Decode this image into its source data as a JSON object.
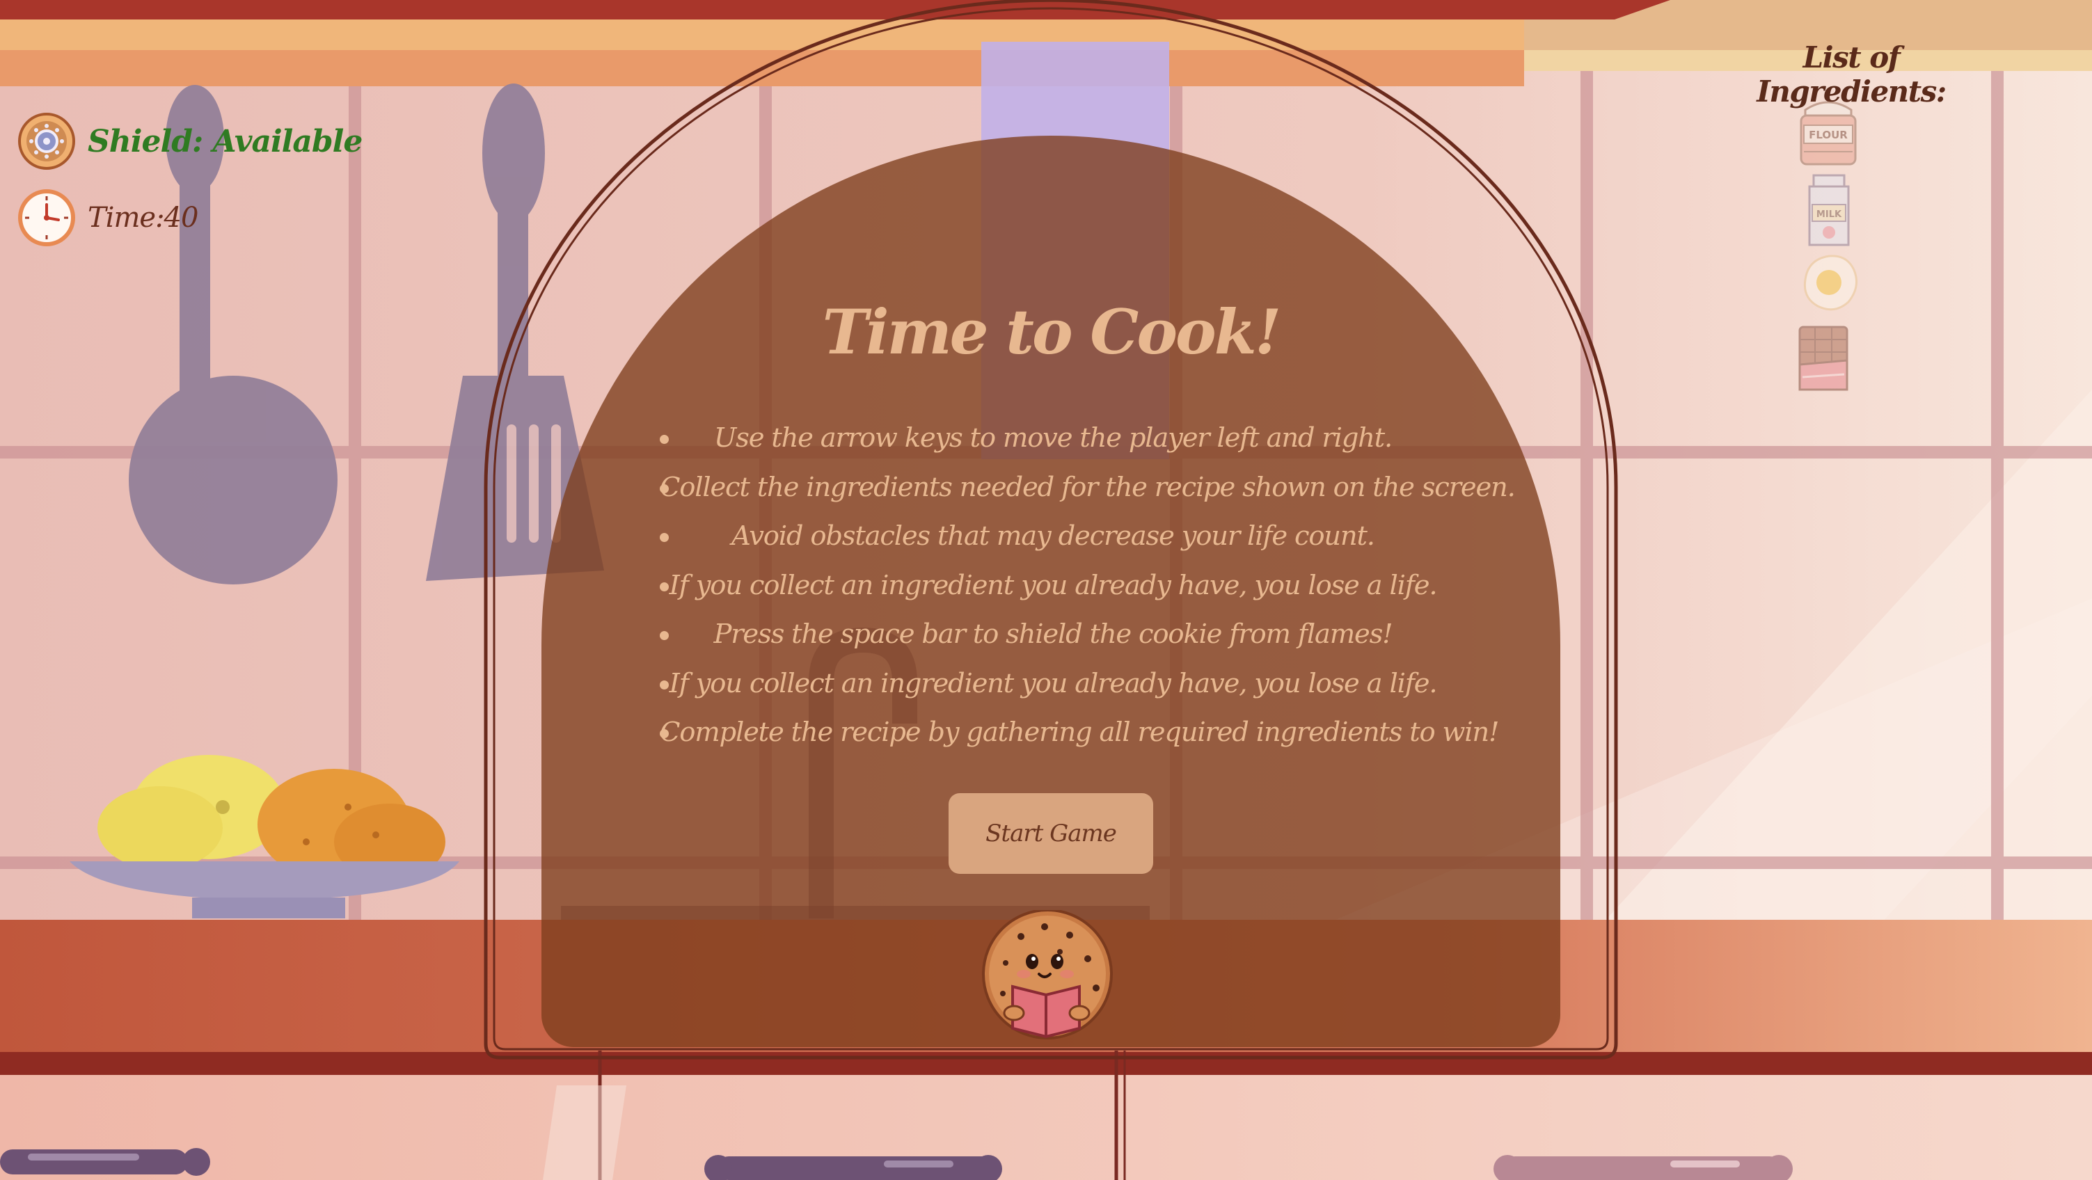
{
  "hud": {
    "shield_label": "Shield: Available",
    "time_label": "Time:40"
  },
  "ingredients": {
    "title": "List of Ingredients:",
    "items": [
      {
        "name": "flour",
        "label": "FLOUR",
        "collected": false
      },
      {
        "name": "milk",
        "label": "MILK",
        "collected": false
      },
      {
        "name": "egg",
        "collected": false
      },
      {
        "name": "chocolate",
        "collected": false
      }
    ]
  },
  "modal": {
    "title": "Time to Cook!",
    "rules": [
      "Use the arrow keys to move the player left and right.",
      "Collect the ingredients needed for the recipe shown on the screen.",
      "Avoid obstacles that may decrease your life count.",
      "If you collect an ingredient you already have, you lose a life.",
      "Press the space bar to shield the cookie from flames!",
      "If you collect an ingredient you already have, you lose a life.",
      "Complete the recipe by gathering all required ingredients to win!"
    ],
    "start_button": "Start Game"
  },
  "colors": {
    "shield_text": "#2f7b22",
    "modal_bg": "#7d3e1c",
    "modal_text": "#e8b890",
    "button_bg": "#d9a57f"
  }
}
